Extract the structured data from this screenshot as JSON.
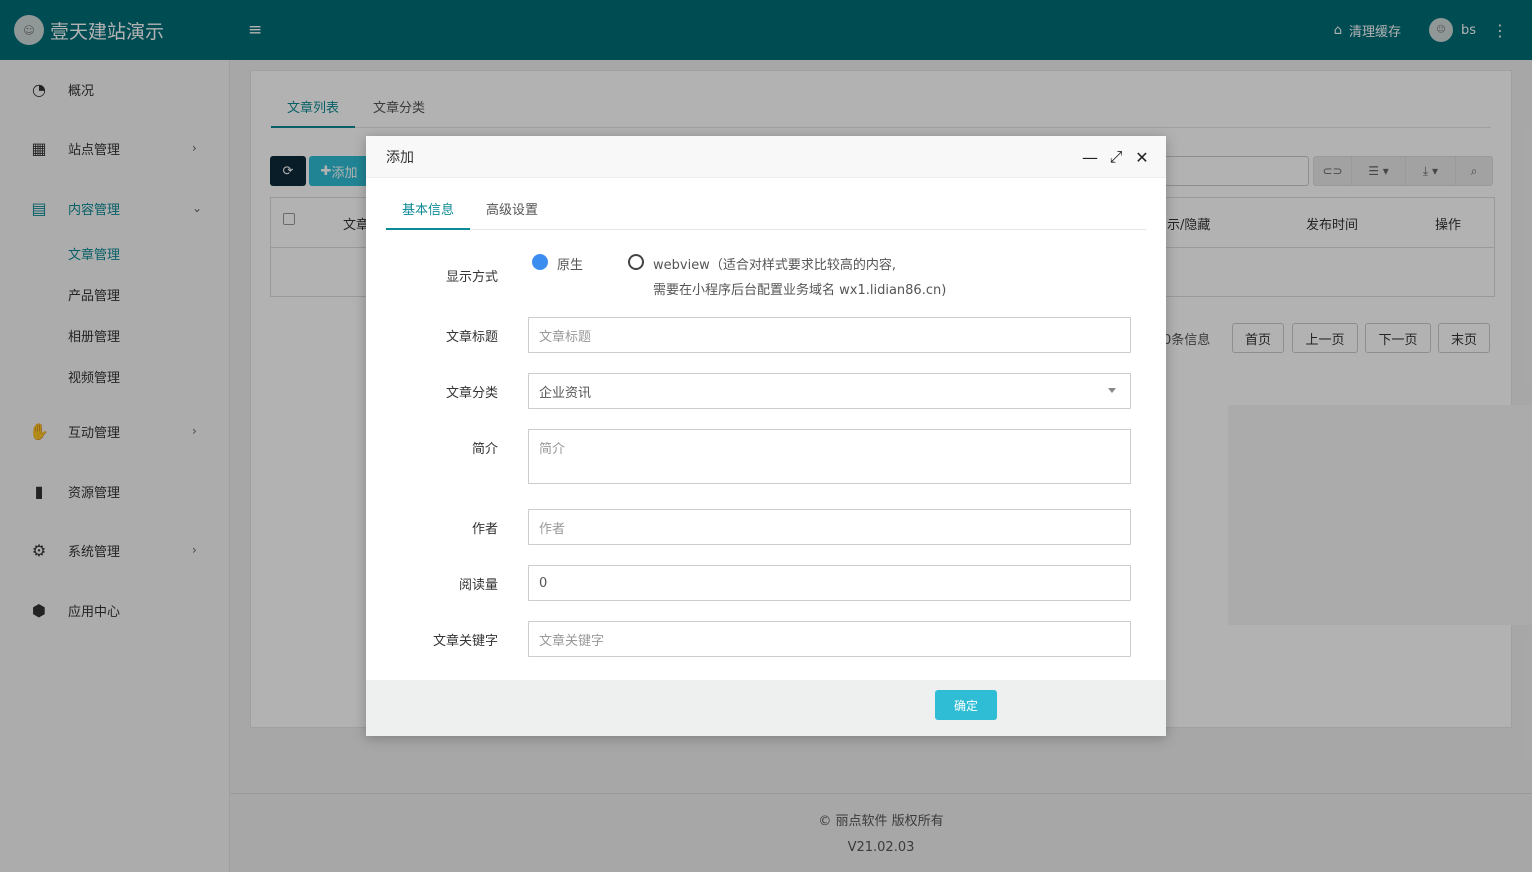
{
  "header": {
    "brand": "壹天建站演示",
    "clear_cache": "清理缓存",
    "username": "bs"
  },
  "sidebar": {
    "items": [
      {
        "label": "概况",
        "icon": "dashboard-icon"
      },
      {
        "label": "站点管理",
        "icon": "grid-icon"
      },
      {
        "label": "内容管理",
        "icon": "document-icon"
      },
      {
        "label": "互动管理",
        "icon": "handshake-icon"
      },
      {
        "label": "资源管理",
        "icon": "file-icon"
      },
      {
        "label": "系统管理",
        "icon": "gear-icon"
      },
      {
        "label": "应用中心",
        "icon": "cube-icon"
      }
    ],
    "sub_items": [
      "文章管理",
      "产品管理",
      "相册管理",
      "视频管理"
    ]
  },
  "main": {
    "tabs": [
      "文章列表",
      "文章分类"
    ],
    "add_label": "添加",
    "columns": [
      "文章",
      "示/隐藏",
      "发布时间",
      "操作"
    ],
    "page_info": "0条信息",
    "pager": [
      "首页",
      "上一页",
      "下一页",
      "末页"
    ]
  },
  "footer": {
    "copyright": "© 丽点软件 版权所有",
    "version": "V21.02.03"
  },
  "modal": {
    "title": "添加",
    "tabs": [
      "基本信息",
      "高级设置"
    ],
    "display_mode": {
      "label": "显示方式",
      "option_native": "原生",
      "option_webview": "webview（适合对样式要求比较高的内容,",
      "option_webview_line2": "需要在小程序后台配置业务域名 wx1.lidian86.cn)"
    },
    "fields": {
      "title_label": "文章标题",
      "title_placeholder": "文章标题",
      "category_label": "文章分类",
      "category_value": "企业资讯",
      "summary_label": "简介",
      "summary_placeholder": "简介",
      "author_label": "作者",
      "author_placeholder": "作者",
      "views_label": "阅读量",
      "views_value": "0",
      "keywords_label": "文章关键字",
      "keywords_placeholder": "文章关键字"
    },
    "ok_label": "确定"
  },
  "colors": {
    "header": "#006d77",
    "accent": "#0b8a95",
    "radio_on": "#3b8ef0",
    "ok_button": "#2ebdd4"
  }
}
